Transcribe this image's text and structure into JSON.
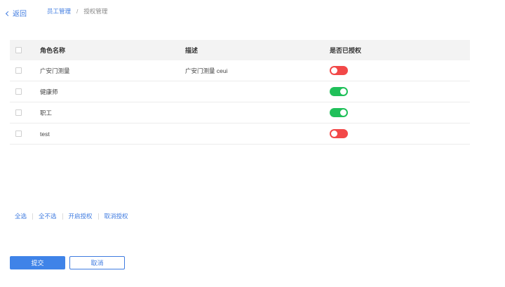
{
  "header": {
    "back_label": "返回",
    "breadcrumb": [
      "员工管理",
      "/",
      "授权管理"
    ]
  },
  "table": {
    "columns": [
      "角色名称",
      "描述",
      "是否已授权"
    ],
    "rows": [
      {
        "name": "广安门测量",
        "desc": "广安门测量 ceui",
        "authorized": false
      },
      {
        "name": "健康师",
        "desc": "",
        "authorized": true
      },
      {
        "name": "职工",
        "desc": "",
        "authorized": true
      },
      {
        "name": "test",
        "desc": "",
        "authorized": false
      }
    ]
  },
  "bulk_actions": [
    "全选",
    "全不选",
    "开启授权",
    "取消授权"
  ],
  "footer": {
    "submit_label": "提交",
    "cancel_label": "取消"
  },
  "colors": {
    "accent": "#3f7be0",
    "switch_on": "#20c05a",
    "switch_off": "#f24848"
  }
}
